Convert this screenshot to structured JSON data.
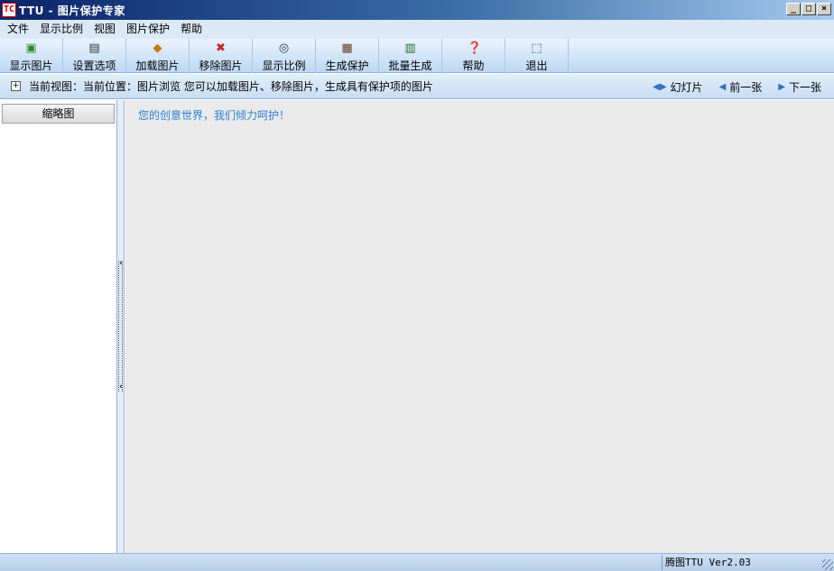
{
  "window": {
    "logo_text": "TC",
    "title": "TTU - 图片保护专家",
    "controls": [
      "_",
      "□",
      "×"
    ]
  },
  "menu": [
    "文件",
    "显示比例",
    "视图",
    "图片保护",
    "帮助"
  ],
  "toolbar": [
    {
      "label": "显示图片",
      "icon": "image-view-icon",
      "glyph": "▣",
      "color": "#2a8a2a"
    },
    {
      "label": "设置选项",
      "icon": "settings-icon",
      "glyph": "▤",
      "color": "#333333"
    },
    {
      "label": "加载图片",
      "icon": "load-image-icon",
      "glyph": "◆",
      "color": "#c07a10"
    },
    {
      "label": "移除图片",
      "icon": "remove-image-icon",
      "glyph": "✖",
      "color": "#cc2222"
    },
    {
      "label": "显示比例",
      "icon": "zoom-icon",
      "glyph": "◎",
      "color": "#333333"
    },
    {
      "label": "生成保护",
      "icon": "protect-icon",
      "glyph": "▦",
      "color": "#6a3a20"
    },
    {
      "label": "批量生成",
      "icon": "batch-icon",
      "glyph": "▥",
      "color": "#2a6a2a"
    },
    {
      "label": "帮助",
      "icon": "help-icon",
      "glyph": "❓",
      "color": "#c09000"
    },
    {
      "label": "退出",
      "icon": "exit-icon",
      "glyph": "⬚",
      "color": "#333333"
    }
  ],
  "nav": {
    "expand": "+",
    "breadcrumb": "当前视图：当前位置：图片浏览  您可以加载图片、移除图片，生成具有保护项的图片",
    "links": [
      {
        "label": "幻灯片",
        "arrow": "◀▶"
      },
      {
        "label": "前一张",
        "arrow": "◀"
      },
      {
        "label": "下一张",
        "arrow": "▶"
      }
    ]
  },
  "left_panel": {
    "header": "缩略图"
  },
  "splitter": {
    "up_arrow": "‹",
    "down_arrow": "‹"
  },
  "main": {
    "slogan": "您的创意世界，我们倾力呵护！"
  },
  "status": {
    "version": "腾图TTU Ver2.03"
  }
}
